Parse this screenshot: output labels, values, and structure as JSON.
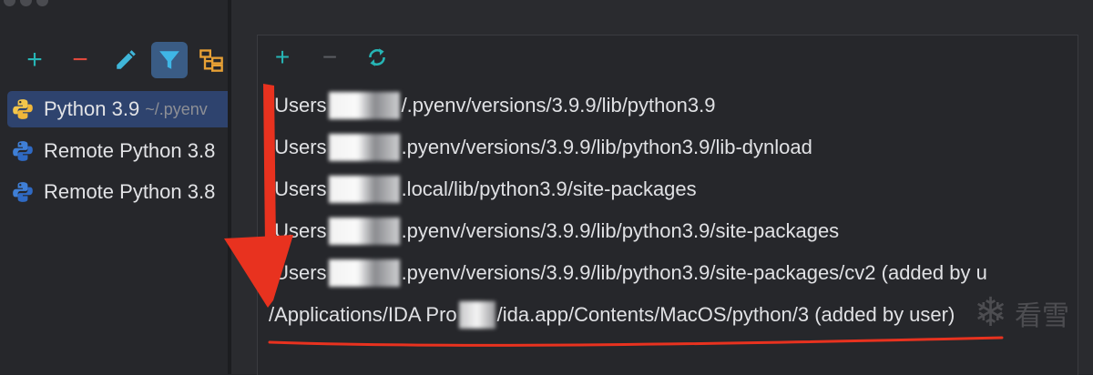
{
  "left_panel": {
    "toolbar": {
      "add_label": "+",
      "remove_label": "−",
      "edit_icon": "pencil-icon",
      "filter_icon": "filter-icon",
      "tree_icon": "tree-icon"
    },
    "interpreters": [
      {
        "name": "Python 3.9",
        "path": "~/.pyenv",
        "icon": "python-icon",
        "selected": true
      },
      {
        "name": "Remote Python 3.8",
        "path": "",
        "icon": "python-icon",
        "selected": false
      },
      {
        "name": "Remote Python 3.8",
        "path": "",
        "icon": "python-icon",
        "selected": false
      }
    ]
  },
  "right_panel": {
    "toolbar": {
      "add_label": "+",
      "remove_label": "−",
      "refresh_icon": "refresh-icon"
    },
    "paths": [
      {
        "prefix": "/Users",
        "suffix": "/.pyenv/versions/3.9.9/lib/python3.9"
      },
      {
        "prefix": "/Users",
        "suffix": ".pyenv/versions/3.9.9/lib/python3.9/lib-dynload"
      },
      {
        "prefix": "/Users",
        "suffix": ".local/lib/python3.9/site-packages"
      },
      {
        "prefix": "/Users",
        "suffix": ".pyenv/versions/3.9.9/lib/python3.9/site-packages"
      },
      {
        "prefix": "/Users",
        "suffix": ".pyenv/versions/3.9.9/lib/python3.9/site-packages/cv2  (added by u"
      },
      {
        "prefix": "/Applications/IDA Pro",
        "suffix": "/ida.app/Contents/MacOS/python/3  (added by user)"
      }
    ]
  },
  "watermark": {
    "text": "看雪"
  },
  "colors": {
    "accent_teal": "#26b5b5",
    "annotation_red": "#e8321f",
    "selection": "#2e436e"
  }
}
